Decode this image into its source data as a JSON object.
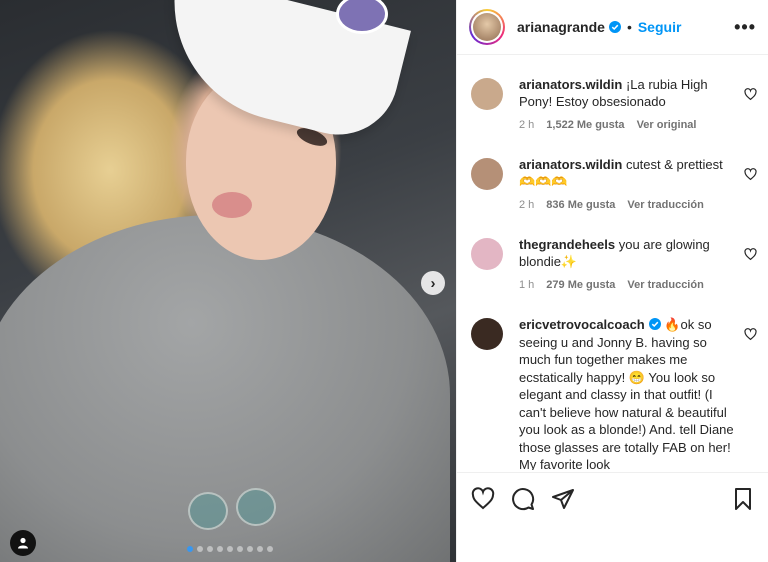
{
  "post": {
    "username": "arianagrande",
    "follow_label": "Seguir",
    "separator": "•",
    "more_label": "•••",
    "carousel_count": 9,
    "carousel_active": 0
  },
  "comments": [
    {
      "user": "arianators.wildin",
      "text": "¡La rubia High Pony! Estoy obsesionado",
      "time": "2 h",
      "likes": "1,522 Me gusta",
      "action": "Ver original",
      "avatar_color": "#c9a98c"
    },
    {
      "user": "arianators.wildin",
      "text": "cutest & prettiest 🫶🫶🫶",
      "time": "2 h",
      "likes": "836 Me gusta",
      "action": "Ver traducción",
      "avatar_color": "#b59077"
    },
    {
      "user": "thegrandeheels",
      "text": "you are glowing blondie✨",
      "time": "1 h",
      "likes": "279 Me gusta",
      "action": "Ver traducción",
      "avatar_color": "#e3b6c4"
    },
    {
      "user": "ericvetrovocalcoach",
      "text": "🔥ok so seeing u and Jonny B. having so much fun together makes me ecstatically happy! 😁 You look so elegant and classy in that outfit! (I can't believe how natural & beautiful you look as a blonde!) And. tell Diane those glasses are totally FAB on her! My favorite look",
      "avatar_color": "#3a2a22"
    }
  ],
  "colors": {
    "accent": "#0095f6",
    "verified": "#0095f6",
    "text": "#262626",
    "muted": "#8e8e8e"
  }
}
